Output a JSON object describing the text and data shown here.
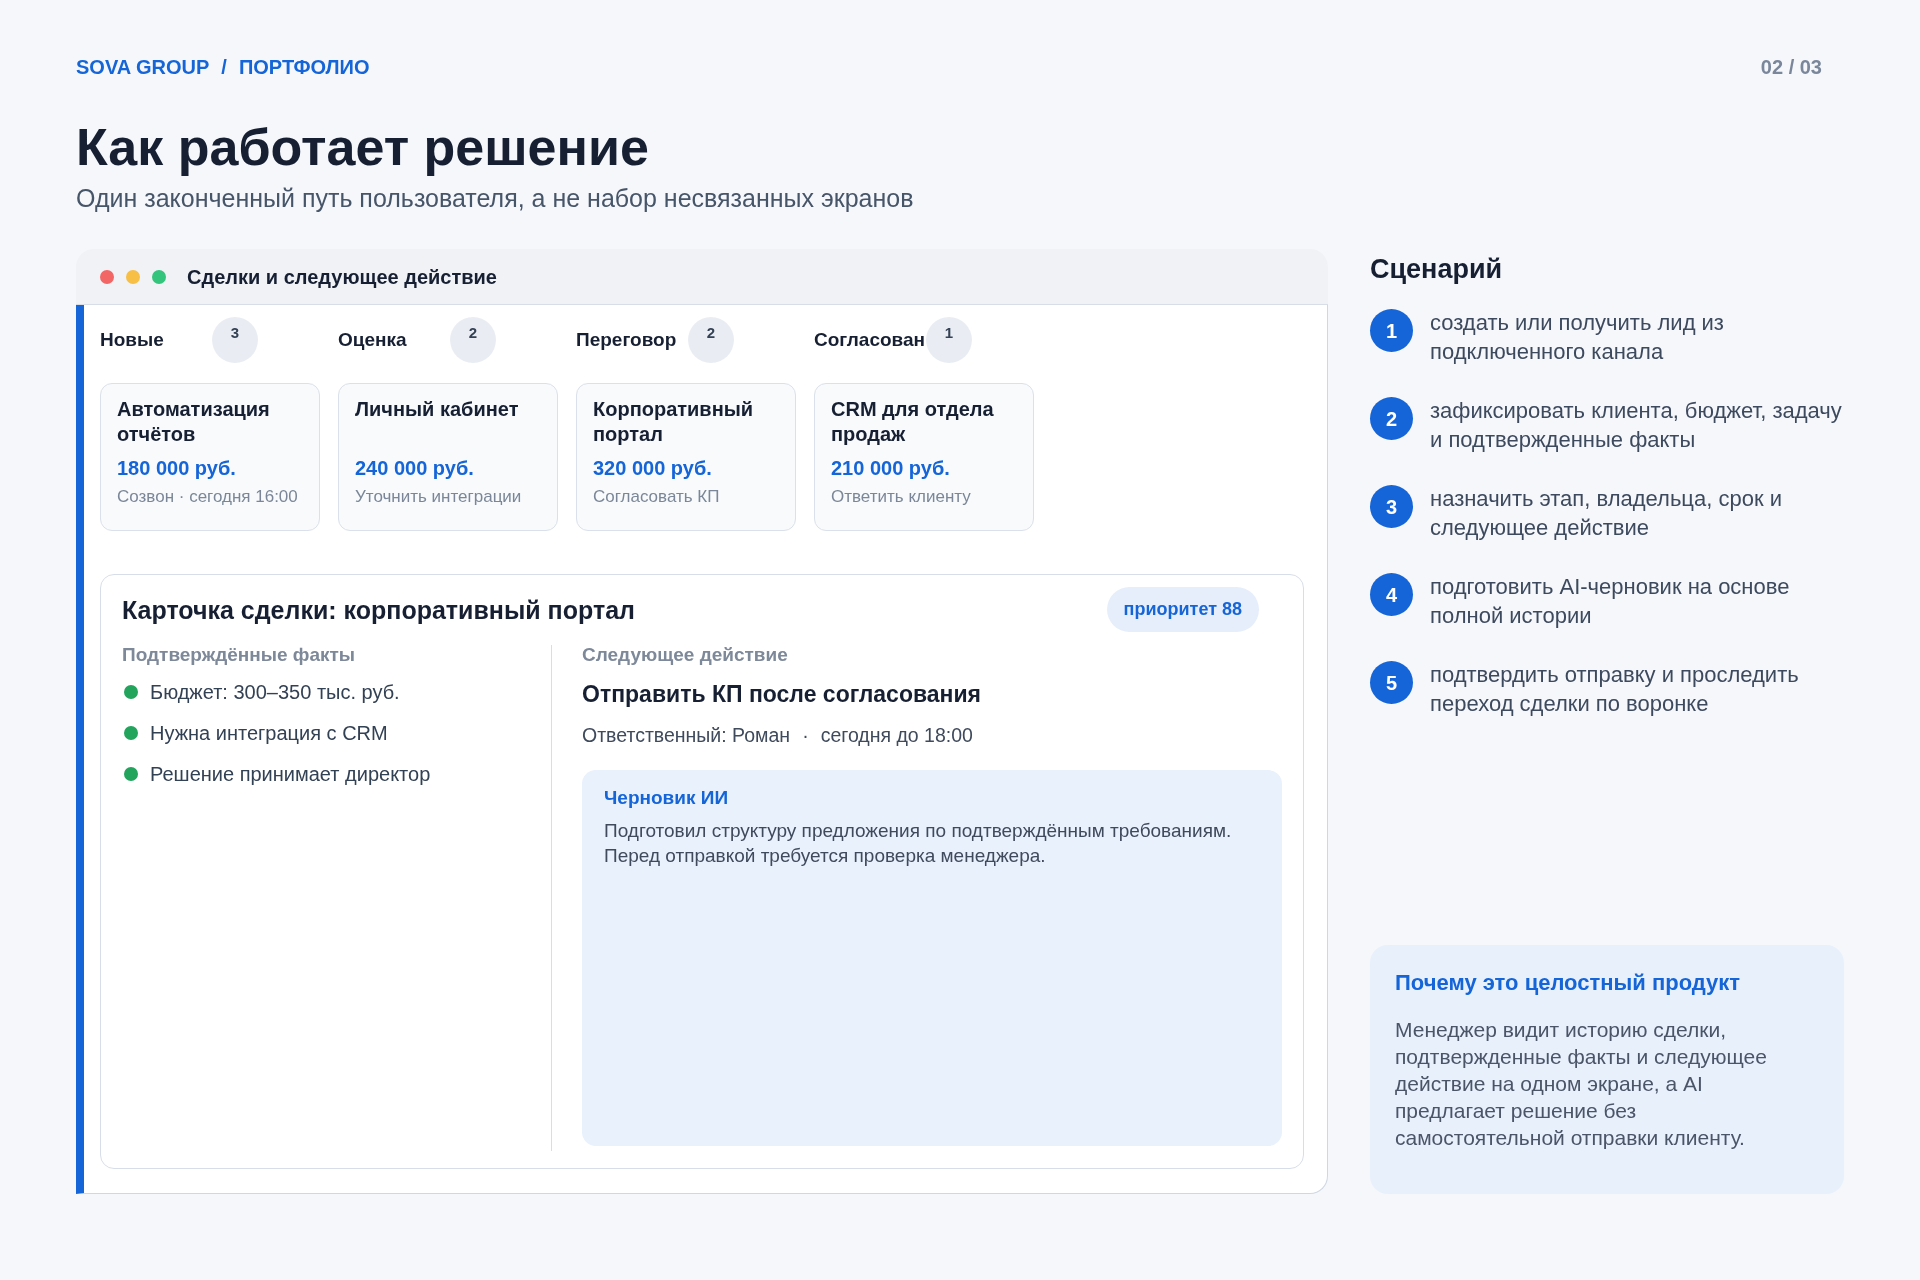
{
  "header": {
    "breadcrumb": [
      "SOVA GROUP",
      "ПОРТФОЛИО"
    ],
    "breadcrumb_separator": "/",
    "page_counter": "02 / 03"
  },
  "title": "Как работает решение",
  "subtitle": "Один законченный путь пользователя, а не набор несвязанных экранов",
  "window": {
    "title": "Сделки и следующее действие",
    "pipeline": [
      {
        "stage": "Новые",
        "count": "3",
        "deals": [
          {
            "title": "Автоматизация отчётов",
            "amount": "180 000 руб.",
            "note": "Созвон · сегодня 16:00"
          }
        ]
      },
      {
        "stage": "Оценка",
        "count": "2",
        "deals": [
          {
            "title": "Личный кабинет",
            "amount": "240 000 руб.",
            "note": "Уточнить интеграции"
          }
        ]
      },
      {
        "stage": "Переговор",
        "count": "2",
        "deals": [
          {
            "title": "Корпоративный портал",
            "amount": "320 000 руб.",
            "note": "Согласовать КП"
          }
        ]
      },
      {
        "stage": "Согласован",
        "count": "1",
        "deals": [
          {
            "title": "CRM для отдела продаж",
            "amount": "210 000 руб.",
            "note": "Ответить клиенту"
          }
        ]
      }
    ],
    "deal_card": {
      "title": "Карточка сделки: корпоративный портал",
      "priority": "приоритет 88",
      "facts_heading": "Подтверждённые факты",
      "facts": [
        "Бюджет: 300–350 тыс. руб.",
        "Нужна интеграция с CRM",
        "Решение принимает директор"
      ],
      "next_action": {
        "heading": "Следующее действие",
        "title": "Отправить КП после согласования",
        "owner": "Ответственный: Роман",
        "separator": "·",
        "due": "сегодня до 18:00"
      },
      "ai_draft": {
        "title": "Черновик ИИ",
        "text": "Подготовил структуру предложения по подтверждённым требованиям. Перед отправкой требуется проверка менеджера."
      }
    }
  },
  "scenario": {
    "title": "Сценарий",
    "steps": [
      {
        "number": "1",
        "text": "создать или получить лид из подключенного канала"
      },
      {
        "number": "2",
        "text": "зафиксировать клиента, бюджет, задачу и подтвержденные факты"
      },
      {
        "number": "3",
        "text": "назначить этап, владельца, срок и следующее действие"
      },
      {
        "number": "4",
        "text": "подготовить AI-черновик на основе полной истории"
      },
      {
        "number": "5",
        "text": "подтвердить отправку и проследить переход сделки по воронке"
      }
    ]
  },
  "note": {
    "title": "Почему это целостный продукт",
    "text": "Менеджер видит историю сделки, подтвержденные факты и следующее действие на одном экране, а AI предлагает решение без самостоятельной отправки клиенту."
  }
}
